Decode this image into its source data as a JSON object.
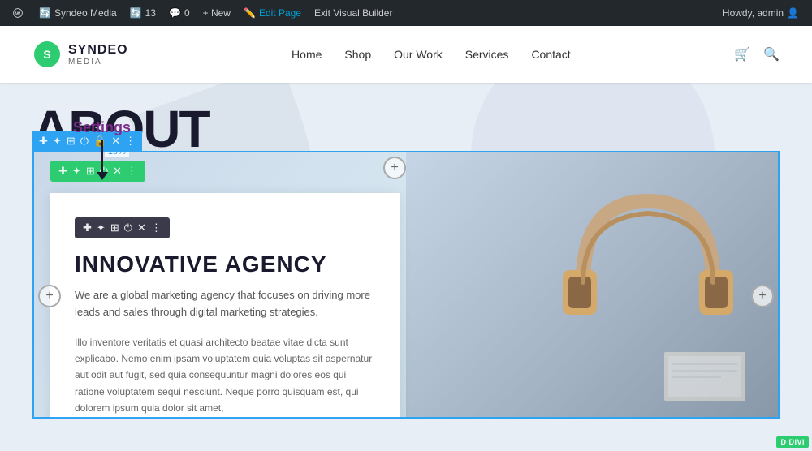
{
  "admin_bar": {
    "wp_label": "W",
    "site_name": "Syndeo Media",
    "updates_count": "13",
    "comments_count": "0",
    "new_label": "+ New",
    "edit_page_label": "Edit Page",
    "exit_builder_label": "Exit Visual Builder",
    "howdy_label": "Howdy, admin"
  },
  "header": {
    "logo_name": "SYNDEO",
    "logo_sub": "MEDIA",
    "nav_items": [
      {
        "label": "Home"
      },
      {
        "label": "Shop"
      },
      {
        "label": "Our Work"
      },
      {
        "label": "Services"
      },
      {
        "label": "Contact"
      }
    ]
  },
  "page": {
    "about_title": "ABOUT",
    "settings_annotation": "Settings",
    "percentage_label": "10%"
  },
  "builder": {
    "outer_toolbar_icons": [
      "✚",
      "✦",
      "⊞",
      "⏻",
      "✕",
      "⋮"
    ],
    "inner_toolbar_icons": [
      "✚",
      "✦",
      "⊞",
      "⏻",
      "✕",
      "⋮"
    ],
    "card_toolbar_icons": [
      "✚",
      "✦",
      "⊞",
      "✕",
      "⋮"
    ],
    "card": {
      "heading": "INNOVATIVE AGENCY",
      "subtitle": "We are a global marketing agency that focuses on driving more leads and sales through digital marketing strategies.",
      "body": "Illo inventore veritatis et quasi architecto beatae vitae dicta sunt explicabo. Nemo enim ipsam voluptatem quia voluptas sit aspernatur aut odit aut fugit, sed quia consequuntur magni dolores eos qui ratione voluptatem sequi nesciunt. Neque porro quisquam est, qui dolorem ipsum quia dolor sit amet,"
    },
    "divi_badge": "D DIVI"
  }
}
